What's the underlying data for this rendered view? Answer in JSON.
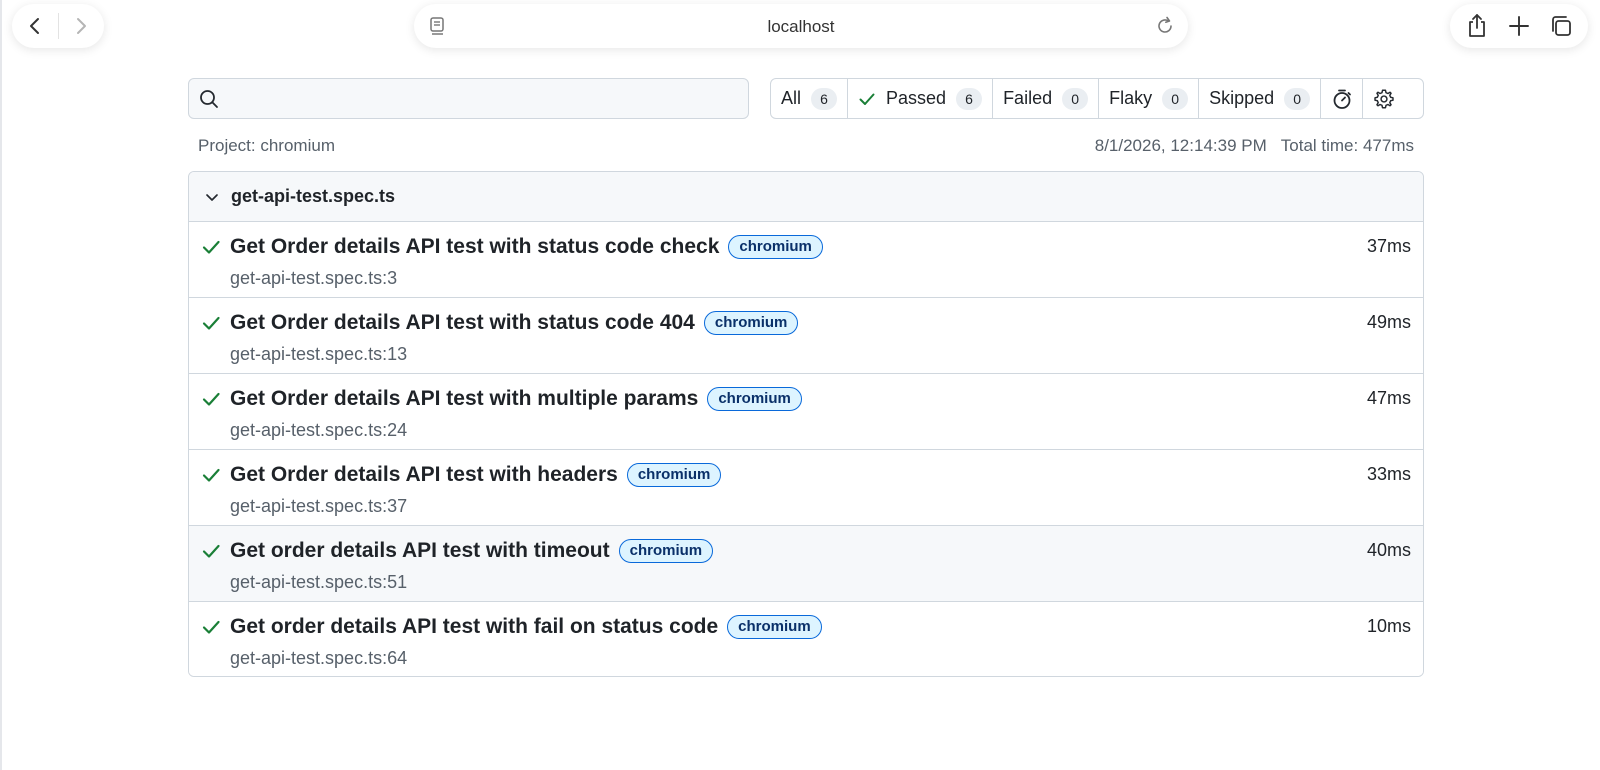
{
  "browser": {
    "url": "localhost"
  },
  "search": {
    "value": "",
    "placeholder": ""
  },
  "filters": [
    {
      "label": "All",
      "count": "6"
    },
    {
      "label": "Passed",
      "count": "6"
    },
    {
      "label": "Failed",
      "count": "0"
    },
    {
      "label": "Flaky",
      "count": "0"
    },
    {
      "label": "Skipped",
      "count": "0"
    }
  ],
  "meta": {
    "project": "Project: chromium",
    "timestamp": "8/1/2026, 12:14:39 PM",
    "total_time": "Total time: 477ms"
  },
  "file": {
    "name": "get-api-test.spec.ts",
    "tests": [
      {
        "title": "Get Order details API test with status code check",
        "label": "chromium",
        "location": "get-api-test.spec.ts:3",
        "duration": "37ms"
      },
      {
        "title": "Get Order details API test with status code 404",
        "label": "chromium",
        "location": "get-api-test.spec.ts:13",
        "duration": "49ms"
      },
      {
        "title": "Get Order details API test with multiple params",
        "label": "chromium",
        "location": "get-api-test.spec.ts:24",
        "duration": "47ms"
      },
      {
        "title": "Get Order details API test with headers",
        "label": "chromium",
        "location": "get-api-test.spec.ts:37",
        "duration": "33ms"
      },
      {
        "title": "Get order details API test with timeout",
        "label": "chromium",
        "location": "get-api-test.spec.ts:51",
        "duration": "40ms"
      },
      {
        "title": "Get order details API test with fail on status code",
        "label": "chromium",
        "location": "get-api-test.spec.ts:64",
        "duration": "10ms"
      }
    ]
  },
  "icons": {
    "back": "chevron-left-icon",
    "forward": "chevron-right-icon",
    "reader": "reader-icon",
    "reload": "reload-icon",
    "share": "share-icon",
    "new_tab": "plus-icon",
    "tabs": "tabs-icon",
    "search": "search-icon",
    "passed": "check-icon",
    "timer": "stopwatch-icon",
    "settings": "gear-icon",
    "collapse": "chevron-down-icon"
  },
  "colors": {
    "pass_green": "#1a7f37",
    "chip_bg": "#ddf4ff",
    "chip_border": "#0969da",
    "chip_text": "#0a3069"
  }
}
